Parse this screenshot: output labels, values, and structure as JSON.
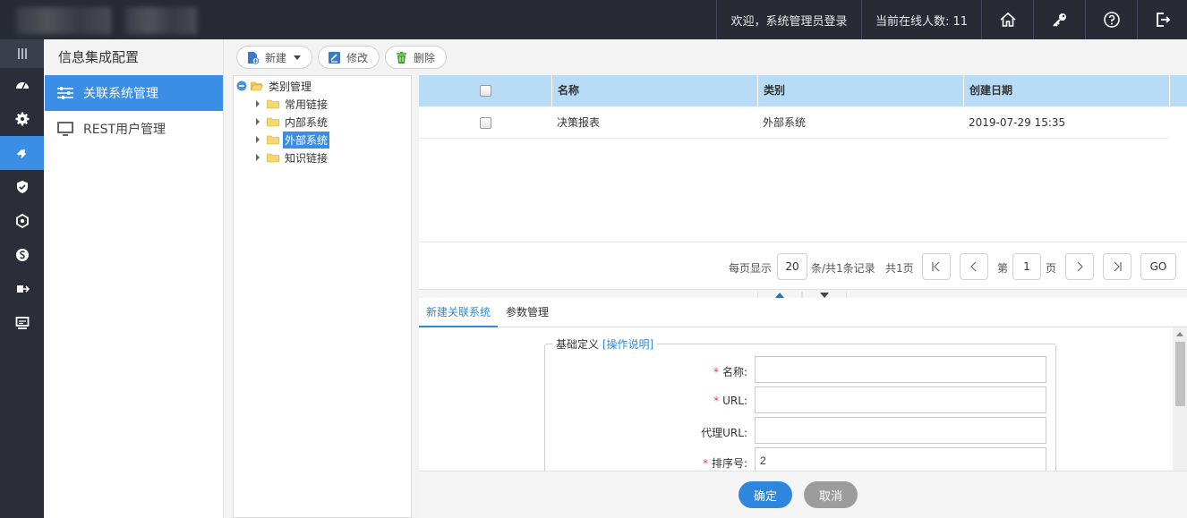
{
  "topbar": {
    "welcome": "欢迎，系统管理员登录",
    "online": "当前在线人数: 11"
  },
  "sidebar": {
    "title": "信息集成配置",
    "items": [
      {
        "label": "关联系统管理"
      },
      {
        "label": "REST用户管理"
      }
    ]
  },
  "toolbar": {
    "new_label": "新建",
    "edit_label": "修改",
    "delete_label": "删除"
  },
  "tree": {
    "root": "类别管理",
    "children": [
      "常用链接",
      "内部系统",
      "外部系统",
      "知识链接"
    ]
  },
  "grid": {
    "columns": [
      "名称",
      "类别",
      "创建日期"
    ],
    "rows": [
      {
        "name": "决策报表",
        "category": "外部系统",
        "created": "2019-07-29 15:35"
      }
    ]
  },
  "pager": {
    "per_page_label": "每页显示",
    "per_page": "20",
    "summary": "条/共1条记录",
    "pages": "共1页",
    "page_prefix": "第",
    "page": "1",
    "page_suffix": "页",
    "go": "GO"
  },
  "tabs": [
    "新建关联系统",
    "参数管理"
  ],
  "form": {
    "legend": "基础定义",
    "help_link": "[操作说明]",
    "fields": [
      {
        "label": "名称:",
        "required": true,
        "value": ""
      },
      {
        "label": "URL:",
        "required": true,
        "value": ""
      },
      {
        "label": "代理URL:",
        "required": false,
        "value": ""
      },
      {
        "label": "排序号:",
        "required": true,
        "value": "2"
      }
    ]
  },
  "footer": {
    "confirm": "确定",
    "cancel": "取消"
  },
  "colors": {
    "accent": "#3a8ee6",
    "topbar": "#282a36",
    "header_row": "#b8dcf6",
    "cancel": "#9c9c9c"
  }
}
